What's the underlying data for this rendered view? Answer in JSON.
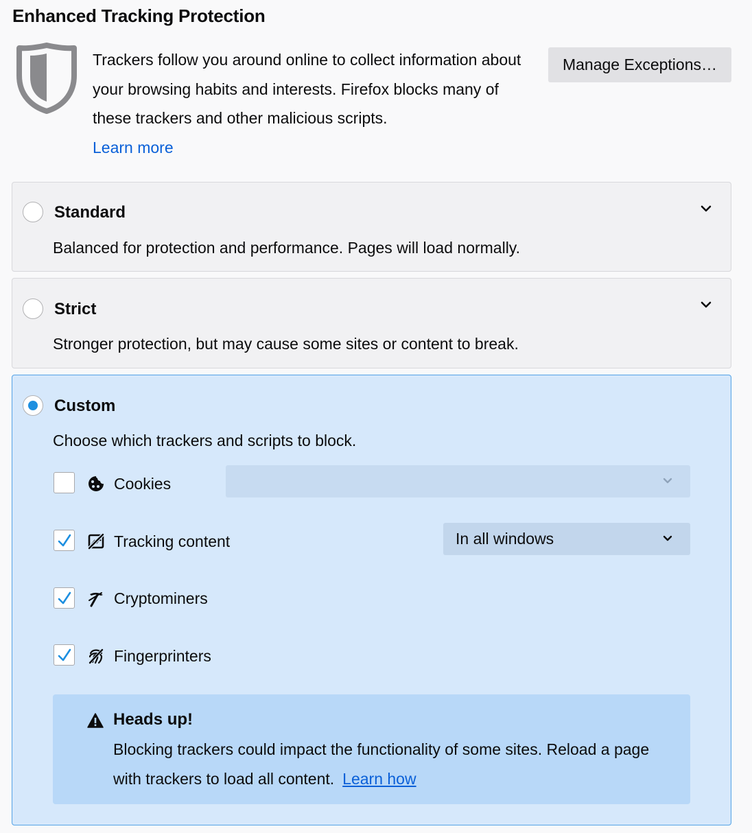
{
  "header": {
    "title": "Enhanced Tracking Protection",
    "description": "Trackers follow you around online to collect information about your browsing habits and interests. Firefox blocks many of these trackers and other malicious scripts.",
    "learn_more": "Learn more",
    "manage_exceptions": "Manage Exceptions…",
    "icon": "shield-icon"
  },
  "options": [
    {
      "key": "standard",
      "title": "Standard",
      "description": "Balanced for protection and performance. Pages will load normally.",
      "selected": false
    },
    {
      "key": "strict",
      "title": "Strict",
      "description": "Stronger protection, but may cause some sites or content to break.",
      "selected": false
    },
    {
      "key": "custom",
      "title": "Custom",
      "description": "Choose which trackers and scripts to block.",
      "selected": true
    }
  ],
  "custom": {
    "rows": [
      {
        "label": "Cookies",
        "checked": false,
        "icon": "cookie-icon",
        "select": {
          "value": "",
          "disabled": true
        }
      },
      {
        "label": "Tracking content",
        "checked": true,
        "icon": "tracking-content-icon",
        "select": {
          "value": "In all windows",
          "disabled": false
        }
      },
      {
        "label": "Cryptominers",
        "checked": true,
        "icon": "cryptominer-icon"
      },
      {
        "label": "Fingerprinters",
        "checked": true,
        "icon": "fingerprint-icon"
      }
    ],
    "warning": {
      "icon": "warning-icon",
      "title": "Heads up!",
      "body": "Blocking trackers could impact the functionality of some sites. Reload a page with trackers to load all content.",
      "link": "Learn how"
    }
  },
  "colors": {
    "accent": "#0a60d8",
    "radio_selected": "#1d8fe0",
    "selected_card_bg": "#d6e8fb",
    "warning_bg": "#b8d8f8"
  }
}
